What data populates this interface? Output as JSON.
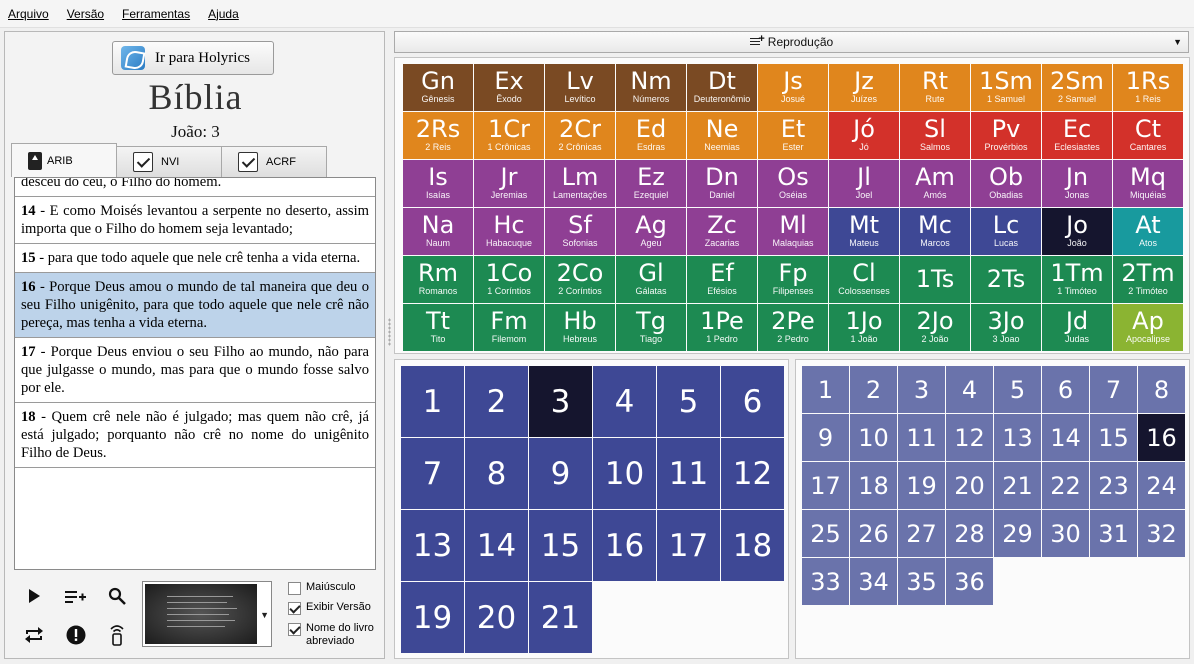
{
  "menu": [
    "Arquivo",
    "Versão",
    "Ferramentas",
    "Ajuda"
  ],
  "left": {
    "goto_label": "Ir para Holyrics",
    "book_title": "Bíblia",
    "chapter_title": "João: 3",
    "tabs": [
      {
        "label": "ARIB",
        "active": true,
        "locked": true
      },
      {
        "label": "NVI",
        "checked": true
      },
      {
        "label": "ACRF",
        "checked": true
      }
    ],
    "partial_verse_text": "desceu do céu, o Filho do homem.",
    "verses": [
      {
        "num": "14",
        "text": " - E como Moisés levantou a serpente no deserto, assim importa que o Filho do homem seja levantado;"
      },
      {
        "num": "15",
        "text": " - para que todo aquele que nele crê tenha a vida eterna."
      },
      {
        "num": "16",
        "text": " - Porque Deus amou o mundo de tal maneira que deu o seu Filho unigênito, para que todo aquele que nele crê não pereça, mas tenha a vida eterna."
      },
      {
        "num": "17",
        "text": " - Porque Deus enviou o seu Filho ao mundo, não para que julgasse o mundo, mas para que o mundo fosse salvo por ele."
      },
      {
        "num": "18",
        "text": " - Quem crê nele não é julgado; mas quem não crê, já está julgado; porquanto não crê no nome do unigênito Filho de Deus."
      }
    ],
    "selected_verse_index": 2,
    "options": [
      {
        "label": "Maiúsculo",
        "checked": false
      },
      {
        "label": "Exibir Versão",
        "checked": true
      },
      {
        "label": "Nome do livro abreviado",
        "checked": true
      }
    ],
    "controls": [
      "play-icon",
      "add-to-playlist-icon",
      "search-icon",
      "repeat-icon",
      "alert-icon",
      "remote-icon"
    ]
  },
  "playback": {
    "label": "Reprodução"
  },
  "colors": {
    "law": "#7a4a23",
    "history": "#e0861d",
    "poetry": "#d3312a",
    "prophets": "#8f3f94",
    "gospels": "#3e4895",
    "acts": "#189a9e",
    "epistles": "#1d8a52",
    "revelation": "#8bb432",
    "current": "#15152e",
    "chapter": "#3e4895",
    "verse": "#6a73ab"
  },
  "books": [
    {
      "abbr": "Gn",
      "name": "Gênesis",
      "group": "law"
    },
    {
      "abbr": "Ex",
      "name": "Êxodo",
      "group": "law"
    },
    {
      "abbr": "Lv",
      "name": "Levítico",
      "group": "law"
    },
    {
      "abbr": "Nm",
      "name": "Números",
      "group": "law"
    },
    {
      "abbr": "Dt",
      "name": "Deuteronômio",
      "group": "law"
    },
    {
      "abbr": "Js",
      "name": "Josué",
      "group": "history"
    },
    {
      "abbr": "Jz",
      "name": "Juízes",
      "group": "history"
    },
    {
      "abbr": "Rt",
      "name": "Rute",
      "group": "history"
    },
    {
      "abbr": "1Sm",
      "name": "1 Samuel",
      "group": "history"
    },
    {
      "abbr": "2Sm",
      "name": "2 Samuel",
      "group": "history"
    },
    {
      "abbr": "1Rs",
      "name": "1 Reis",
      "group": "history"
    },
    {
      "abbr": "2Rs",
      "name": "2 Reis",
      "group": "history"
    },
    {
      "abbr": "1Cr",
      "name": "1 Crônicas",
      "group": "history"
    },
    {
      "abbr": "2Cr",
      "name": "2 Crônicas",
      "group": "history"
    },
    {
      "abbr": "Ed",
      "name": "Esdras",
      "group": "history"
    },
    {
      "abbr": "Ne",
      "name": "Neemias",
      "group": "history"
    },
    {
      "abbr": "Et",
      "name": "Ester",
      "group": "history"
    },
    {
      "abbr": "Jó",
      "name": "Jó",
      "group": "poetry"
    },
    {
      "abbr": "Sl",
      "name": "Salmos",
      "group": "poetry"
    },
    {
      "abbr": "Pv",
      "name": "Provérbios",
      "group": "poetry"
    },
    {
      "abbr": "Ec",
      "name": "Eclesiastes",
      "group": "poetry"
    },
    {
      "abbr": "Ct",
      "name": "Cantares",
      "group": "poetry"
    },
    {
      "abbr": "Is",
      "name": "Isaías",
      "group": "prophets"
    },
    {
      "abbr": "Jr",
      "name": "Jeremias",
      "group": "prophets"
    },
    {
      "abbr": "Lm",
      "name": "Lamentações",
      "group": "prophets"
    },
    {
      "abbr": "Ez",
      "name": "Ezequiel",
      "group": "prophets"
    },
    {
      "abbr": "Dn",
      "name": "Daniel",
      "group": "prophets"
    },
    {
      "abbr": "Os",
      "name": "Oséias",
      "group": "prophets"
    },
    {
      "abbr": "Jl",
      "name": "Joel",
      "group": "prophets"
    },
    {
      "abbr": "Am",
      "name": "Amós",
      "group": "prophets"
    },
    {
      "abbr": "Ob",
      "name": "Obadias",
      "group": "prophets"
    },
    {
      "abbr": "Jn",
      "name": "Jonas",
      "group": "prophets"
    },
    {
      "abbr": "Mq",
      "name": "Miquéias",
      "group": "prophets"
    },
    {
      "abbr": "Na",
      "name": "Naum",
      "group": "prophets"
    },
    {
      "abbr": "Hc",
      "name": "Habacuque",
      "group": "prophets"
    },
    {
      "abbr": "Sf",
      "name": "Sofonias",
      "group": "prophets"
    },
    {
      "abbr": "Ag",
      "name": "Ageu",
      "group": "prophets"
    },
    {
      "abbr": "Zc",
      "name": "Zacarias",
      "group": "prophets"
    },
    {
      "abbr": "Ml",
      "name": "Malaquias",
      "group": "prophets"
    },
    {
      "abbr": "Mt",
      "name": "Mateus",
      "group": "gospels"
    },
    {
      "abbr": "Mc",
      "name": "Marcos",
      "group": "gospels"
    },
    {
      "abbr": "Lc",
      "name": "Lucas",
      "group": "gospels"
    },
    {
      "abbr": "Jo",
      "name": "João",
      "group": "gospels",
      "current": true
    },
    {
      "abbr": "At",
      "name": "Atos",
      "group": "acts"
    },
    {
      "abbr": "Rm",
      "name": "Romanos",
      "group": "epistles"
    },
    {
      "abbr": "1Co",
      "name": "1 Coríntios",
      "group": "epistles"
    },
    {
      "abbr": "2Co",
      "name": "2 Coríntios",
      "group": "epistles"
    },
    {
      "abbr": "Gl",
      "name": "Gálatas",
      "group": "epistles"
    },
    {
      "abbr": "Ef",
      "name": "Efésios",
      "group": "epistles"
    },
    {
      "abbr": "Fp",
      "name": "Filipenses",
      "group": "epistles"
    },
    {
      "abbr": "Cl",
      "name": "Colossenses",
      "group": "epistles"
    },
    {
      "abbr": "1Ts",
      "name": "",
      "group": "epistles"
    },
    {
      "abbr": "2Ts",
      "name": "",
      "group": "epistles"
    },
    {
      "abbr": "1Tm",
      "name": "1 Timóteo",
      "group": "epistles"
    },
    {
      "abbr": "2Tm",
      "name": "2 Timóteo",
      "group": "epistles"
    },
    {
      "abbr": "Tt",
      "name": "Tito",
      "group": "epistles"
    },
    {
      "abbr": "Fm",
      "name": "Filemom",
      "group": "epistles"
    },
    {
      "abbr": "Hb",
      "name": "Hebreus",
      "group": "epistles"
    },
    {
      "abbr": "Tg",
      "name": "Tiago",
      "group": "epistles"
    },
    {
      "abbr": "1Pe",
      "name": "1 Pedro",
      "group": "epistles"
    },
    {
      "abbr": "2Pe",
      "name": "2 Pedro",
      "group": "epistles"
    },
    {
      "abbr": "1Jo",
      "name": "1 João",
      "group": "epistles"
    },
    {
      "abbr": "2Jo",
      "name": "2 João",
      "group": "epistles"
    },
    {
      "abbr": "3Jo",
      "name": "3 Joao",
      "group": "epistles"
    },
    {
      "abbr": "Jd",
      "name": "Judas",
      "group": "epistles"
    },
    {
      "abbr": "Ap",
      "name": "Apocalipse",
      "group": "revelation"
    }
  ],
  "chapters": {
    "total": 21,
    "current": 3
  },
  "verse_numbers": {
    "total": 36,
    "current": 16
  }
}
